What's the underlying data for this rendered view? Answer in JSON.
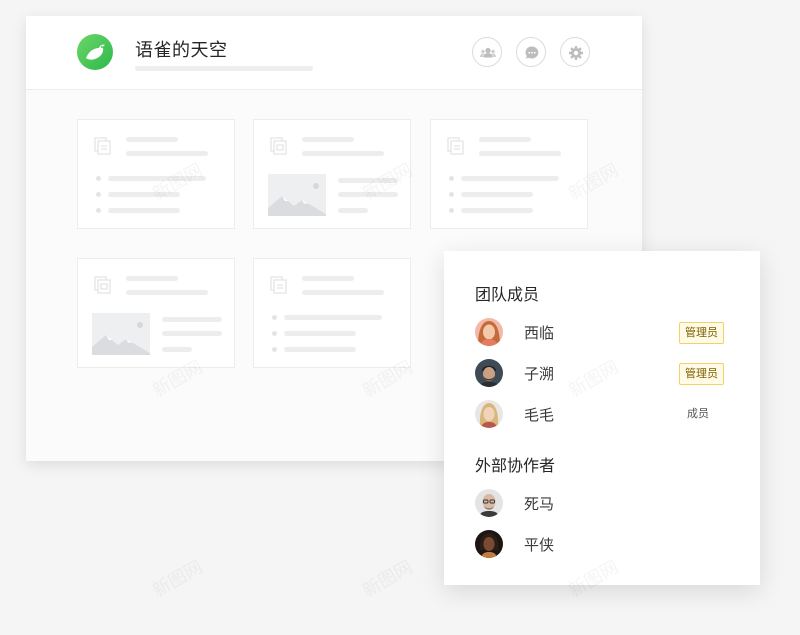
{
  "header": {
    "title": "语雀的天空",
    "icons": [
      "team-icon",
      "chat-icon",
      "settings-icon"
    ]
  },
  "colors": {
    "logo": "#3fc557",
    "badge_border": "#f2d16b",
    "badge_bg": "#fffbe6"
  },
  "members_panel": {
    "team_title": "团队成员",
    "team_members": [
      {
        "name": "西临",
        "role": "管理员",
        "avatar": "avatar-woman-red-hair"
      },
      {
        "name": "子溯",
        "role": "管理员",
        "avatar": "avatar-man-beard"
      },
      {
        "name": "毛毛",
        "role": "成员",
        "avatar": "avatar-woman-blonde"
      }
    ],
    "external_title": "外部协作者",
    "external_members": [
      {
        "name": "死马",
        "avatar": "avatar-bald-man-glasses"
      },
      {
        "name": "平侠",
        "avatar": "avatar-dark-skin-person"
      }
    ]
  },
  "watermark": "新图网"
}
